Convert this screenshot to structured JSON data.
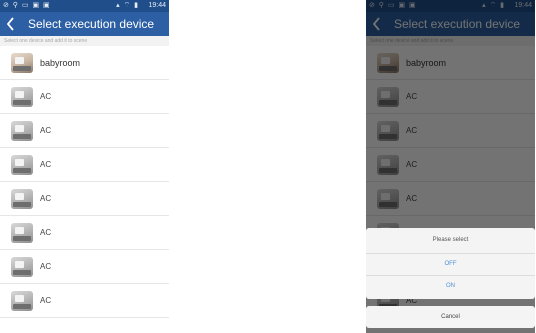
{
  "status_bar": {
    "time": "19:44"
  },
  "header": {
    "title": "Select execution device"
  },
  "hint": "Select one device and add it to scene",
  "devices": [
    {
      "name": "babyroom",
      "icon": "room-photo-icon"
    },
    {
      "name": "AC",
      "icon": "device-photo-icon"
    },
    {
      "name": "AC",
      "icon": "device-photo-icon"
    },
    {
      "name": "AC",
      "icon": "device-photo-icon"
    },
    {
      "name": "AC",
      "icon": "device-photo-icon"
    },
    {
      "name": "AC",
      "icon": "device-photo-icon"
    },
    {
      "name": "AC",
      "icon": "device-photo-icon"
    },
    {
      "name": "AC",
      "icon": "device-photo-icon"
    }
  ],
  "dialog": {
    "title": "Please select",
    "options": [
      "OFF",
      "ON"
    ],
    "cancel": "Cancel"
  },
  "colors": {
    "header": "#2c5fa3",
    "status_bar": "#1f4e8a",
    "option_text": "#4a90d9"
  }
}
